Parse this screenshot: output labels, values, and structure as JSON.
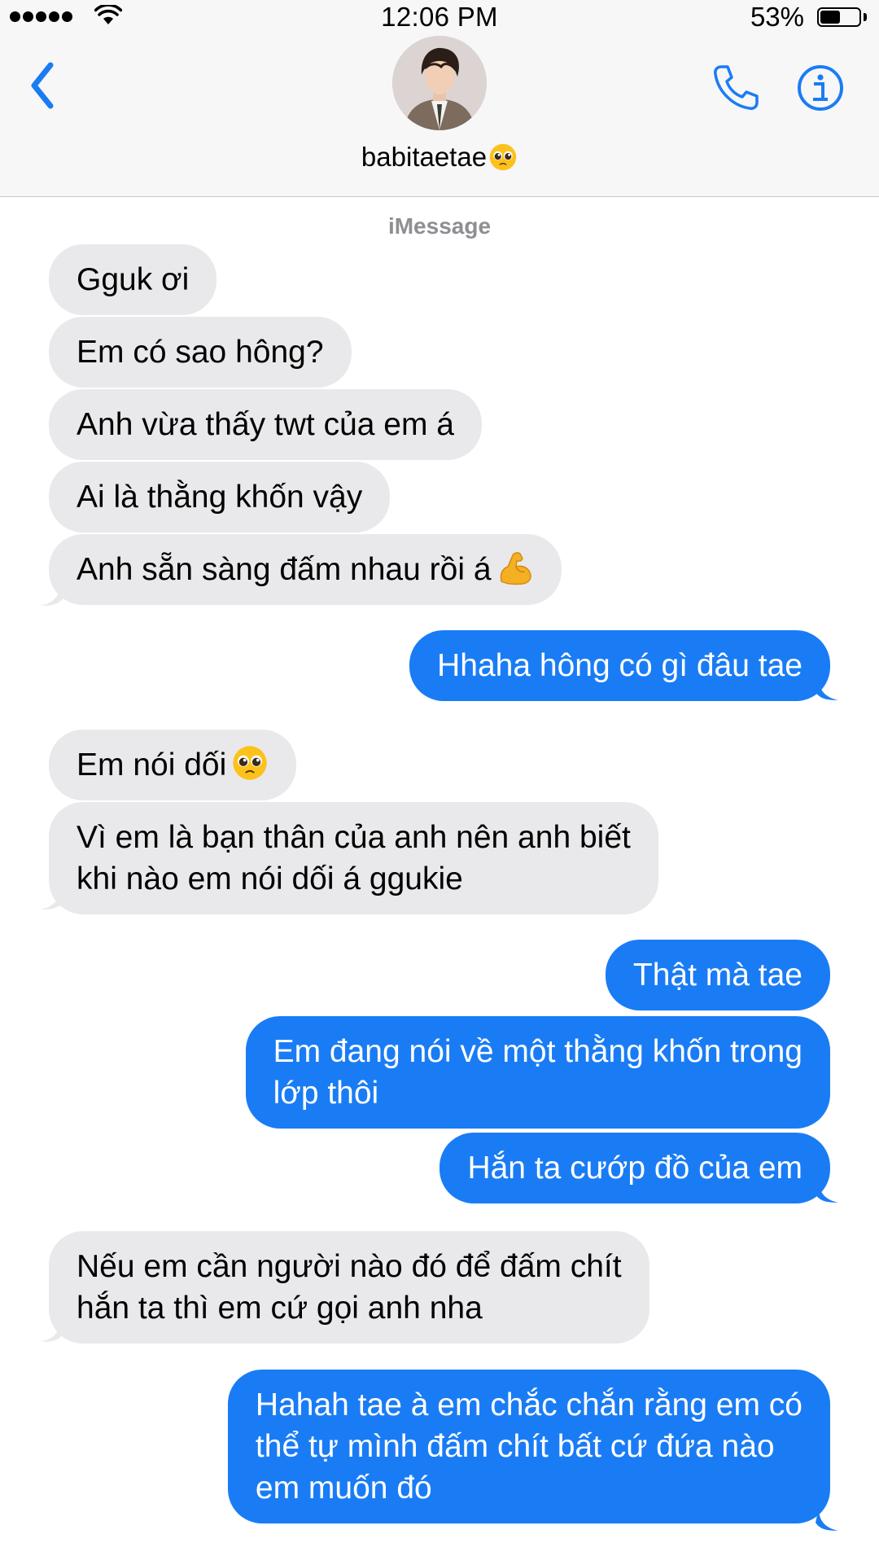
{
  "status_bar": {
    "time": "12:06 PM",
    "battery_percent": "53%",
    "battery_level": 0.53,
    "signal_dots": 5
  },
  "header": {
    "contact_name": "babitaetae",
    "contact_emoji": "pleading-face-emoji",
    "back_icon": "chevron-left-icon",
    "call_icon": "phone-icon",
    "info_icon": "info-icon"
  },
  "thread": {
    "service_label": "iMessage",
    "messages": [
      {
        "direction": "incoming",
        "text": "Gguk ơi"
      },
      {
        "direction": "incoming",
        "text": "Em có sao hông?"
      },
      {
        "direction": "incoming",
        "text": "Anh vừa thấy twt của em á"
      },
      {
        "direction": "incoming",
        "text": "Ai là thằng khốn vậy"
      },
      {
        "direction": "incoming",
        "text": "Anh sẵn sàng đấm nhau rồi á",
        "emoji": "flexed-biceps-emoji"
      },
      {
        "direction": "outgoing",
        "text": "Hhaha hông có gì đâu tae"
      },
      {
        "direction": "incoming",
        "text": "Em nói dối",
        "emoji": "pleading-face-emoji"
      },
      {
        "direction": "incoming",
        "lines": [
          "Vì em là bạn thân của anh nên anh biết",
          "khi nào em nói dối á ggukie"
        ]
      },
      {
        "direction": "outgoing",
        "text": "Thật mà tae"
      },
      {
        "direction": "outgoing",
        "lines": [
          "Em đang nói về một thằng khốn trong",
          "lớp thôi"
        ]
      },
      {
        "direction": "outgoing",
        "text": "Hắn ta cướp đồ của em"
      },
      {
        "direction": "incoming",
        "lines": [
          "Nếu em cần người nào đó để đấm chít",
          "hắn ta thì em cứ gọi anh nha"
        ]
      },
      {
        "direction": "outgoing",
        "lines": [
          "Hahah tae à em chắc chắn rằng em có",
          "thể tự mình đấm chít bất cứ đứa nào",
          "em muốn đó"
        ]
      }
    ]
  },
  "colors": {
    "incoming_bubble": "#e9e9eb",
    "outgoing_bubble": "#1a7cf5",
    "accent": "#1a7cf5",
    "header_bg": "#f7f7f7"
  }
}
